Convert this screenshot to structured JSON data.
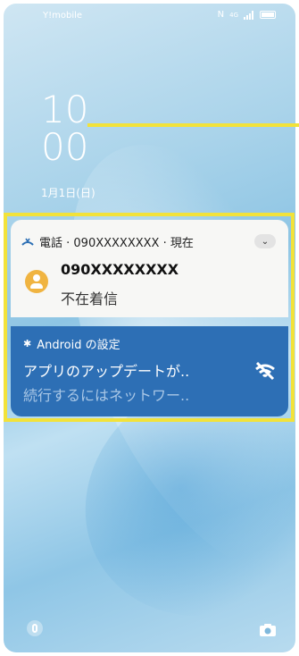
{
  "status_bar": {
    "carrier": "Y!mobile",
    "nfc_icon": "nfc-icon",
    "signal_label": "4G",
    "battery_icon": "battery-icon"
  },
  "clock": {
    "hour": "10",
    "minute": "00",
    "date": "1月1日(日)"
  },
  "notifications": {
    "call": {
      "icon": "missed-call-icon",
      "header": "電話 · 090XXXXXXXX · 現在",
      "caller": "090XXXXXXXX",
      "status": "不在着信"
    },
    "android": {
      "icon": "gear-icon",
      "header": "Android の設定",
      "title": "アプリのアップデートが..",
      "text": "続行するにはネットワー.."
    }
  },
  "colors": {
    "highlight": "#f2e23a",
    "android_card": "#2d6fb5",
    "avatar": "#f0b441"
  }
}
